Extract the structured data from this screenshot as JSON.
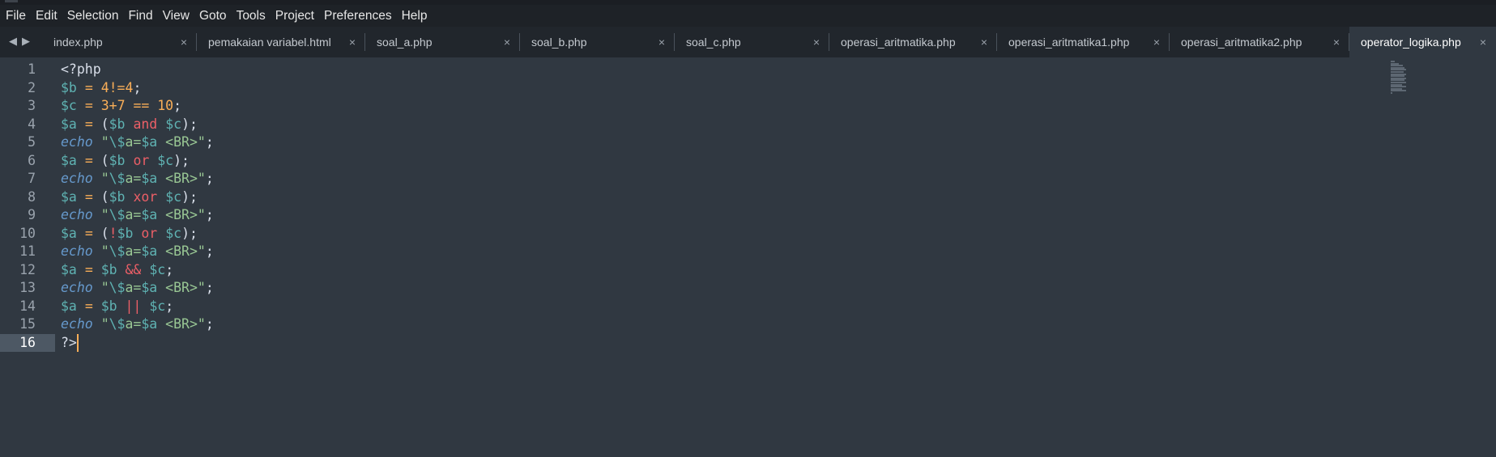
{
  "menubar": {
    "items": [
      "File",
      "Edit",
      "Selection",
      "Find",
      "View",
      "Goto",
      "Tools",
      "Project",
      "Preferences",
      "Help"
    ]
  },
  "tabs": {
    "items": [
      {
        "label": "index.php",
        "close": "×"
      },
      {
        "label": "pemakaian variabel.html",
        "close": "×"
      },
      {
        "label": "soal_a.php",
        "close": "×"
      },
      {
        "label": "soal_b.php",
        "close": "×"
      },
      {
        "label": "soal_c.php",
        "close": "×"
      },
      {
        "label": "operasi_aritmatika.php",
        "close": "×"
      },
      {
        "label": "operasi_aritmatika1.php",
        "close": "×"
      },
      {
        "label": "operasi_aritmatika2.php",
        "close": "×"
      },
      {
        "label": "operator_logika.php",
        "close": "×"
      }
    ],
    "active_index": 8
  },
  "editor": {
    "current_line": 16,
    "line_numbers": [
      "1",
      "2",
      "3",
      "4",
      "5",
      "6",
      "7",
      "8",
      "9",
      "10",
      "11",
      "12",
      "13",
      "14",
      "15",
      "16"
    ],
    "lines": [
      [
        [
          "punc",
          "<?php"
        ]
      ],
      [
        [
          "var",
          "$b"
        ],
        [
          "punc",
          " "
        ],
        [
          "op",
          "="
        ],
        [
          "punc",
          " "
        ],
        [
          "num",
          "4"
        ],
        [
          "op",
          "!="
        ],
        [
          "num",
          "4"
        ],
        [
          "punc",
          ";"
        ]
      ],
      [
        [
          "var",
          "$c"
        ],
        [
          "punc",
          " "
        ],
        [
          "op",
          "="
        ],
        [
          "punc",
          " "
        ],
        [
          "num",
          "3"
        ],
        [
          "op",
          "+"
        ],
        [
          "num",
          "7"
        ],
        [
          "punc",
          " "
        ],
        [
          "op",
          "=="
        ],
        [
          "punc",
          " "
        ],
        [
          "num",
          "10"
        ],
        [
          "punc",
          ";"
        ]
      ],
      [
        [
          "var",
          "$a"
        ],
        [
          "punc",
          " "
        ],
        [
          "op",
          "="
        ],
        [
          "punc",
          " ("
        ],
        [
          "var",
          "$b"
        ],
        [
          "punc",
          " "
        ],
        [
          "kw",
          "and"
        ],
        [
          "punc",
          " "
        ],
        [
          "var",
          "$c"
        ],
        [
          "punc",
          ");"
        ]
      ],
      [
        [
          "echo",
          "echo"
        ],
        [
          "punc",
          " "
        ],
        [
          "str",
          "\""
        ],
        [
          "esc",
          "\\$"
        ],
        [
          "str",
          "a="
        ],
        [
          "var",
          "$a"
        ],
        [
          "str",
          " <BR>"
        ],
        [
          "str",
          "\""
        ],
        [
          "punc",
          ";"
        ]
      ],
      [
        [
          "var",
          "$a"
        ],
        [
          "punc",
          " "
        ],
        [
          "op",
          "="
        ],
        [
          "punc",
          " ("
        ],
        [
          "var",
          "$b"
        ],
        [
          "punc",
          " "
        ],
        [
          "kw",
          "or"
        ],
        [
          "punc",
          " "
        ],
        [
          "var",
          "$c"
        ],
        [
          "punc",
          ");"
        ]
      ],
      [
        [
          "echo",
          "echo"
        ],
        [
          "punc",
          " "
        ],
        [
          "str",
          "\""
        ],
        [
          "esc",
          "\\$"
        ],
        [
          "str",
          "a="
        ],
        [
          "var",
          "$a"
        ],
        [
          "str",
          " <BR>"
        ],
        [
          "str",
          "\""
        ],
        [
          "punc",
          ";"
        ]
      ],
      [
        [
          "var",
          "$a"
        ],
        [
          "punc",
          " "
        ],
        [
          "op",
          "="
        ],
        [
          "punc",
          " ("
        ],
        [
          "var",
          "$b"
        ],
        [
          "punc",
          " "
        ],
        [
          "kw",
          "xor"
        ],
        [
          "punc",
          " "
        ],
        [
          "var",
          "$c"
        ],
        [
          "punc",
          ");"
        ]
      ],
      [
        [
          "echo",
          "echo"
        ],
        [
          "punc",
          " "
        ],
        [
          "str",
          "\""
        ],
        [
          "esc",
          "\\$"
        ],
        [
          "str",
          "a="
        ],
        [
          "var",
          "$a"
        ],
        [
          "str",
          " <BR>"
        ],
        [
          "str",
          "\""
        ],
        [
          "punc",
          ";"
        ]
      ],
      [
        [
          "var",
          "$a"
        ],
        [
          "punc",
          " "
        ],
        [
          "op",
          "="
        ],
        [
          "punc",
          " ("
        ],
        [
          "kw",
          "!"
        ],
        [
          "var",
          "$b"
        ],
        [
          "punc",
          " "
        ],
        [
          "kw",
          "or"
        ],
        [
          "punc",
          " "
        ],
        [
          "var",
          "$c"
        ],
        [
          "punc",
          ");"
        ]
      ],
      [
        [
          "echo",
          "echo"
        ],
        [
          "punc",
          " "
        ],
        [
          "str",
          "\""
        ],
        [
          "esc",
          "\\$"
        ],
        [
          "str",
          "a="
        ],
        [
          "var",
          "$a"
        ],
        [
          "str",
          " <BR>"
        ],
        [
          "str",
          "\""
        ],
        [
          "punc",
          ";"
        ]
      ],
      [
        [
          "var",
          "$a"
        ],
        [
          "punc",
          " "
        ],
        [
          "op",
          "="
        ],
        [
          "punc",
          " "
        ],
        [
          "var",
          "$b"
        ],
        [
          "punc",
          " "
        ],
        [
          "kw",
          "&&"
        ],
        [
          "punc",
          " "
        ],
        [
          "var",
          "$c"
        ],
        [
          "punc",
          ";"
        ]
      ],
      [
        [
          "echo",
          "echo"
        ],
        [
          "punc",
          " "
        ],
        [
          "str",
          "\""
        ],
        [
          "esc",
          "\\$"
        ],
        [
          "str",
          "a="
        ],
        [
          "var",
          "$a"
        ],
        [
          "str",
          " <BR>"
        ],
        [
          "str",
          "\""
        ],
        [
          "punc",
          ";"
        ]
      ],
      [
        [
          "var",
          "$a"
        ],
        [
          "punc",
          " "
        ],
        [
          "op",
          "="
        ],
        [
          "punc",
          " "
        ],
        [
          "var",
          "$b"
        ],
        [
          "punc",
          " "
        ],
        [
          "kw",
          "||"
        ],
        [
          "punc",
          " "
        ],
        [
          "var",
          "$c"
        ],
        [
          "punc",
          ";"
        ]
      ],
      [
        [
          "echo",
          "echo"
        ],
        [
          "punc",
          " "
        ],
        [
          "str",
          "\""
        ],
        [
          "esc",
          "\\$"
        ],
        [
          "str",
          "a="
        ],
        [
          "var",
          "$a"
        ],
        [
          "str",
          " <BR>"
        ],
        [
          "str",
          "\""
        ],
        [
          "punc",
          ";"
        ]
      ],
      [
        [
          "punc",
          "?>"
        ]
      ]
    ]
  },
  "colors": {
    "background": "#303841",
    "variable": "#5fb3b3",
    "operator": "#f9ae58",
    "keyword": "#ec5f67",
    "echo": "#6699cc",
    "string": "#99c794",
    "cursor": "#f9ae58"
  }
}
